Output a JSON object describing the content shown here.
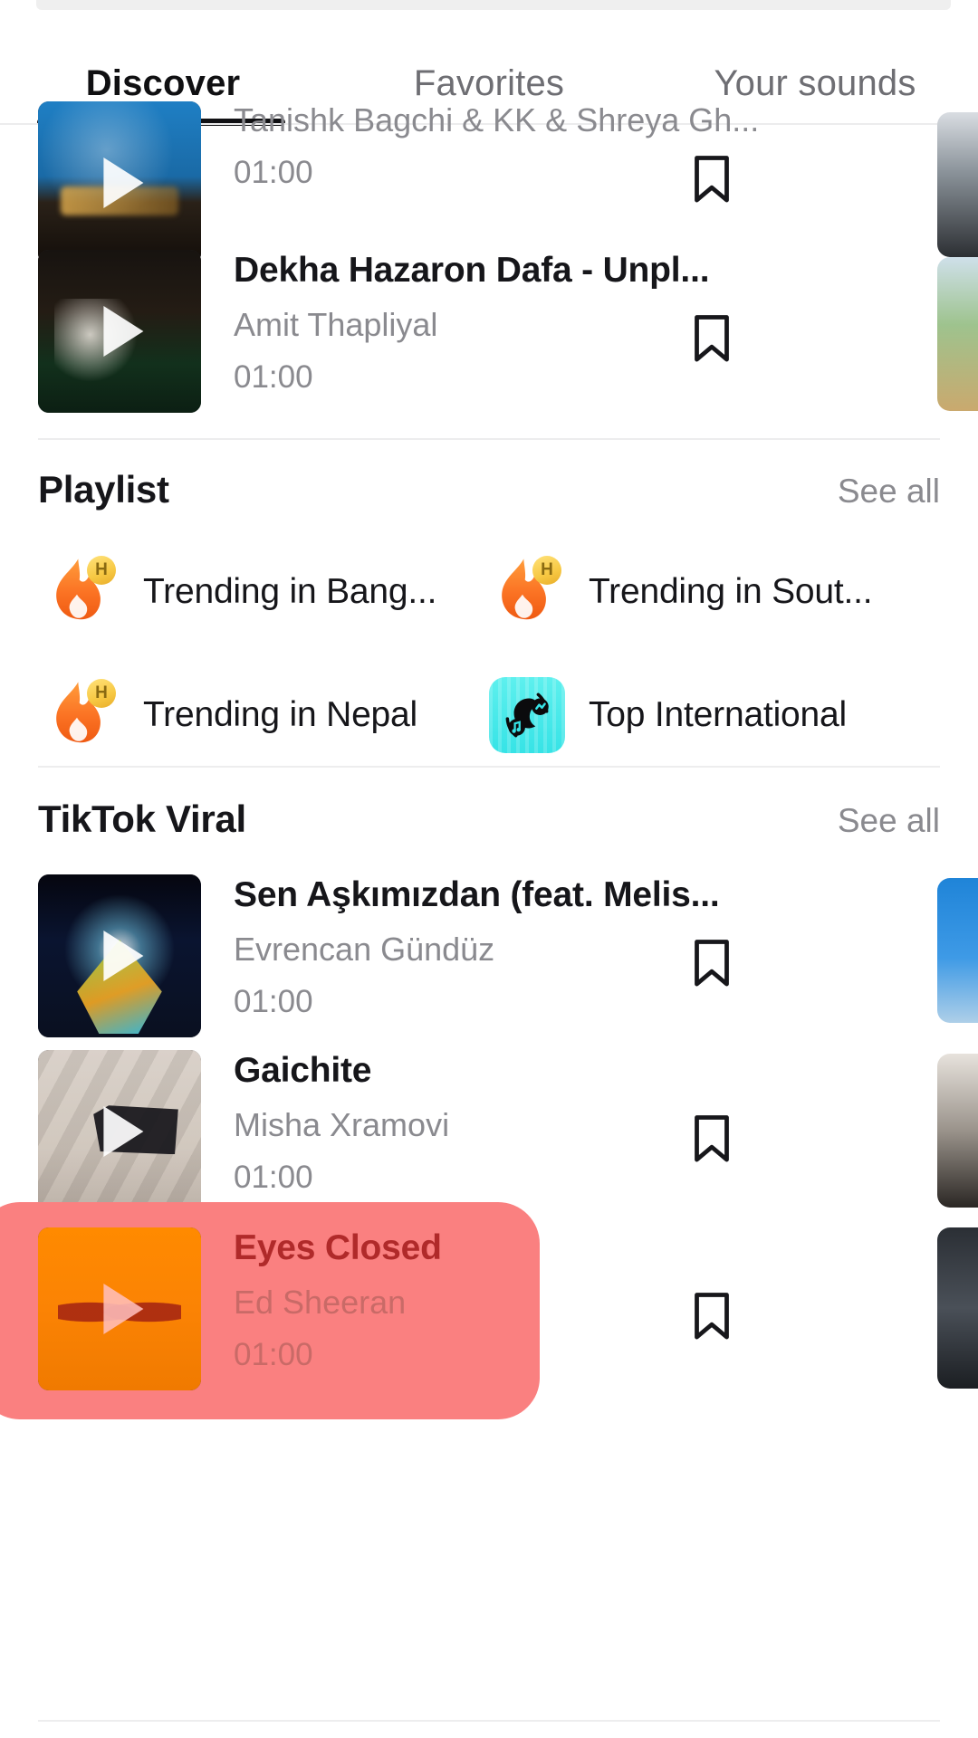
{
  "tabs": [
    {
      "label": "Discover",
      "active": true
    },
    {
      "label": "Favorites",
      "active": false
    },
    {
      "label": "Your sounds",
      "active": false
    }
  ],
  "common": {
    "see_all_label": "See all",
    "bookmark_icon": "bookmark-icon",
    "play_icon": "play-icon"
  },
  "top_list": {
    "sounds": [
      {
        "title": "",
        "artist": "Tanishk Bagchi & KK & Shreya Gh...",
        "duration": "01:00",
        "art": "art-jalebi",
        "saved": false
      },
      {
        "title": "Dekha Hazaron Dafa - Unpl...",
        "artist": "Amit Thapliyal",
        "duration": "01:00",
        "art": "art-dekha",
        "saved": false
      }
    ]
  },
  "playlist_section": {
    "title": "Playlist",
    "see_all_label": "See all",
    "items": [
      {
        "label": "Trending in Bang...",
        "icon": "flame-icon",
        "badge": "H"
      },
      {
        "label": "Trending in Sout...",
        "icon": "flame-icon",
        "badge": "H"
      },
      {
        "label": "Trending in Nepal",
        "icon": "flame-icon",
        "badge": "H"
      },
      {
        "label": "Top International",
        "icon": "globe-music-icon",
        "badge": ""
      }
    ]
  },
  "viral_section": {
    "title": "TikTok Viral",
    "see_all_label": "See all",
    "sounds": [
      {
        "title": "Sen Aşkımızdan (feat. Melis...",
        "artist": "Evrencan Gündüz",
        "duration": "01:00",
        "art": "art-sen",
        "selected": false
      },
      {
        "title": "Gaichite",
        "artist": "Misha Xramovi",
        "duration": "01:00",
        "art": "art-gaichite",
        "selected": false
      },
      {
        "title": "Eyes Closed",
        "artist": "Ed Sheeran",
        "duration": "01:00",
        "art": "art-eyes",
        "selected": true
      }
    ]
  },
  "colors": {
    "accent_highlight": "#fa8080",
    "selected_title": "#b02a2a",
    "selected_subtext": "#c96a67",
    "text_primary": "#16161a",
    "text_secondary": "#8a8a8f",
    "tab_active_underline": "#111114",
    "globe_tile": "#36e3e6"
  }
}
